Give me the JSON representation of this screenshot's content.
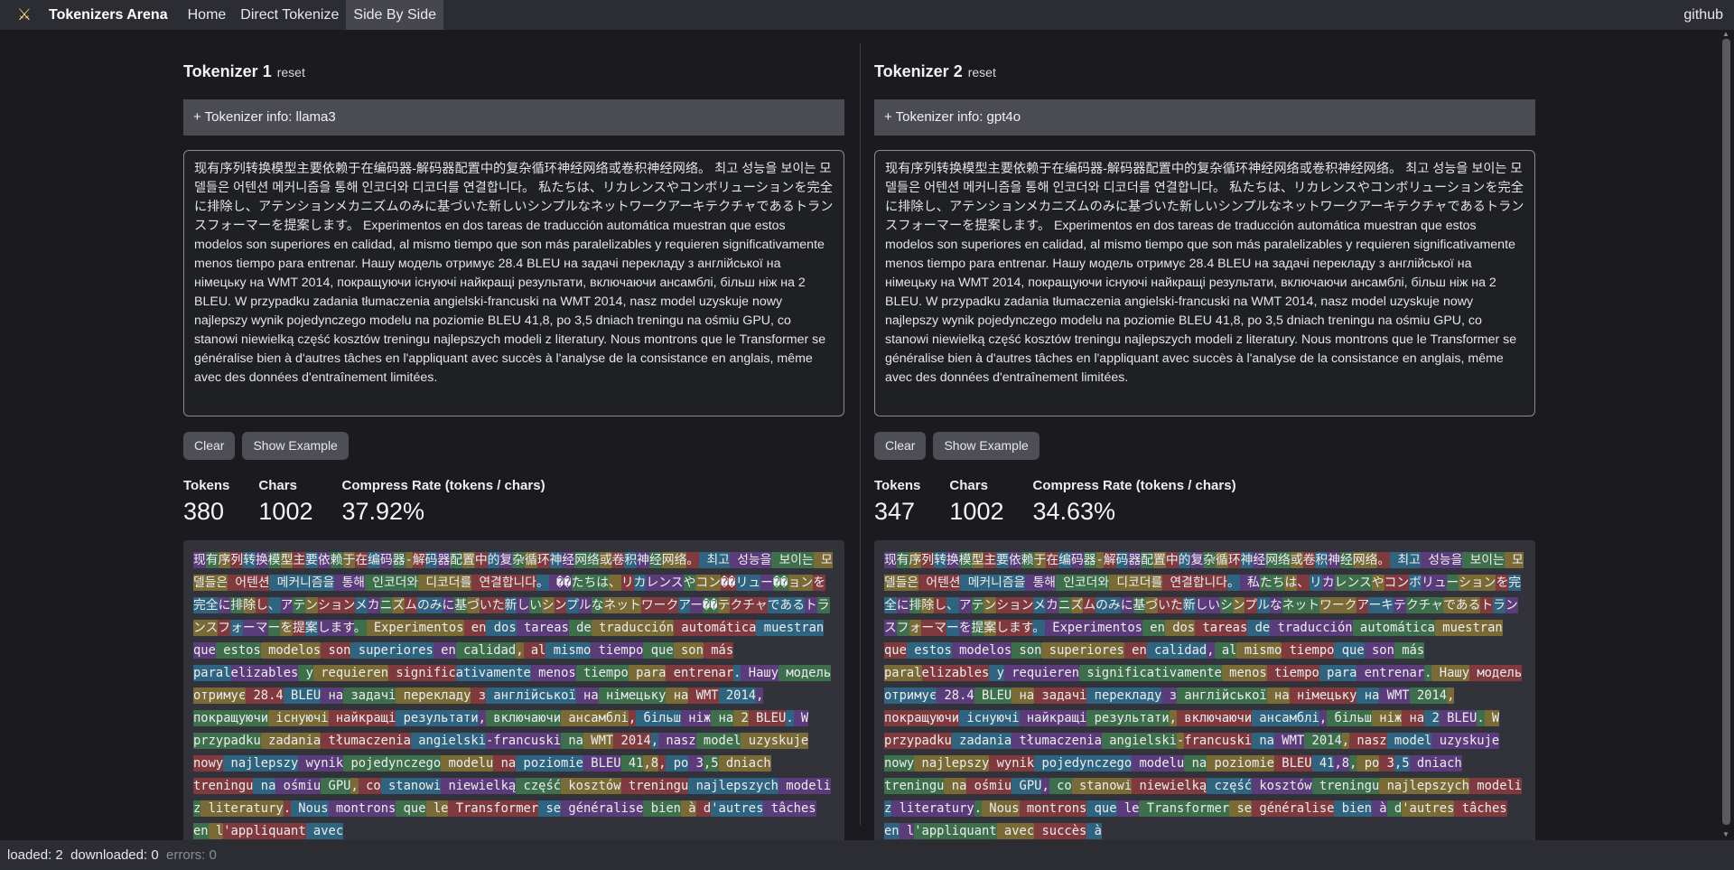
{
  "nav": {
    "brand": "Tokenizers Arena",
    "links": [
      {
        "label": "Home"
      },
      {
        "label": "Direct Tokenize"
      },
      {
        "label": "Side By Side"
      }
    ],
    "github": "github"
  },
  "input_text": "现有序列转换模型主要依赖于在编码器-解码器配置中的复杂循环神经网络或卷积神经网络。 최고 성능을 보이는 모델들은 어텐션 메커니즘을 통해 인코더와 디코더를 연결합니다。 私たちは、リカレンスやコンボリューションを完全に排除し、アテンションメカニズムのみに基づいた新しいシンプルなネットワークアーキテクチャであるトランスフォーマーを提案します。 Experimentos en dos tareas de traducción automática muestran que estos modelos son superiores en calidad, al mismo tiempo que son más paralelizables y requieren significativamente menos tiempo para entrenar. Нашу модель отримує 28.4 BLEU на задачі перекладу з англійської на німецьку на WMT 2014, покращуючи існуючі найкращі результати, включаючи ансамблі, більш ніж на 2 BLEU. W przypadku zadania tłumaczenia angielski-francuski na WMT 2014, nasz model uzyskuje nowy najlepszy wynik pojedynczego modelu na poziomie BLEU 41,8, po 3,5 dniach treningu na ośmiu GPU, co stanowi niewielką część kosztów treningu najlepszych modeli z literatury. Nous montrons que le Transformer se généralise bien à d'autres tâches en l'appliquant avec succès à l'analyse de la consistance en anglais, même avec des données d'entraînement limitées.",
  "buttons": {
    "clear": "Clear",
    "show_example": "Show Example"
  },
  "stat_labels": {
    "tokens": "Tokens",
    "chars": "Chars",
    "compress": "Compress Rate (tokens / chars)"
  },
  "reset_label": "reset",
  "panels": [
    {
      "title": "Tokenizer 1",
      "info": "+ Tokenizer info: llama3",
      "tokens": "380",
      "chars": "1002",
      "compress": "37.92%",
      "token_list": [
        "现",
        "有",
        "序",
        "列",
        "转",
        "换",
        "模",
        "型",
        "主",
        "要",
        "依",
        "赖",
        "于",
        "在",
        "编",
        "码",
        "器",
        "-",
        "解",
        "码",
        "器",
        "配",
        "置",
        "中",
        "的",
        "复",
        "杂",
        "循",
        "环",
        "神",
        "经",
        "网络",
        "或",
        "卷",
        "积",
        "神",
        "经",
        "网络",
        "。",
        " 최고",
        " 성능을",
        " 보이는",
        " 모델들은",
        " 어텐션",
        " 메커니즘을",
        " 통해",
        " 인코더와",
        " 디코더를",
        " 연결합니다",
        "。",
        " ��",
        "たちは",
        "、",
        "リ",
        "カ",
        "レンス",
        "や",
        "コン",
        "��",
        "リュ",
        "ー",
        "��",
        "ョン",
        "を",
        "完全",
        "に",
        "排",
        "除",
        "し",
        "、",
        "ア",
        "テ",
        "ン",
        "ション",
        "メ",
        "カ",
        "ニ",
        "ズ",
        "ム",
        "のみ",
        "に",
        "基",
        "づ",
        "いた",
        "新",
        "し",
        "い",
        "シ",
        "ン",
        "プ",
        "ル",
        "な",
        "ネット",
        "ワーク",
        "ア",
        "ー",
        "��",
        "テ",
        "クチャ",
        "である",
        "ト",
        "ラ",
        "ンス",
        "フ",
        "ォ",
        "ーマ",
        "ー",
        "を",
        "提",
        "案",
        "します",
        "。",
        " Experimentos",
        " en",
        " dos",
        " tareas",
        " de",
        " traducción",
        " automática",
        " muestran",
        " que",
        " estos",
        " modelos",
        " son",
        " superiores",
        " en",
        " calidad",
        ",",
        " al",
        " mismo",
        " tiempo",
        " que",
        " son",
        " más",
        " paral",
        "elizables",
        " y",
        " requieren",
        " signific",
        "ativamente",
        " menos",
        " tiempo",
        " para",
        " entrenar",
        ".",
        " Нашу",
        " модель",
        " отримує",
        " 28.4",
        " BLEU",
        " на",
        " задачі",
        " перекладу",
        " з",
        " англійської",
        " на",
        " німецьку",
        " на",
        " WMT",
        " 2014",
        ",",
        " покращуючи",
        " існуючі",
        " найкращі",
        " результати",
        ",",
        " включаючи",
        " ансамблі",
        ",",
        " більш",
        " ніж",
        " на",
        " 2",
        " BLEU",
        ".",
        " W",
        " przypadku",
        " zadania",
        " tłumaczenia",
        " angielski",
        "-francuski",
        " na",
        " WMT",
        " 2014",
        ",",
        " nasz",
        " model",
        " uzyskuje",
        " nowy",
        " najlepszy",
        " wynik",
        " pojedynczego",
        " modelu",
        " na",
        " poziomie",
        " BLEU",
        " 41",
        ",8",
        ",",
        " po",
        " 3",
        ",5",
        " dniach",
        " treningu",
        " na",
        " ośmiu",
        " GPU",
        ",",
        " co",
        " stanowi",
        " niewielką",
        " część",
        " kosztów",
        " treningu",
        " najlepszych",
        " modeli",
        " z",
        " literatury",
        ".",
        " Nous",
        " montrons",
        " que",
        " le",
        " Transformer",
        " se",
        " généralise",
        " bien",
        " à",
        " d",
        "'autres",
        " tâches",
        " en",
        " l",
        "'appliquant",
        " avec"
      ]
    },
    {
      "title": "Tokenizer 2",
      "info": "+ Tokenizer info: gpt4o",
      "tokens": "347",
      "chars": "1002",
      "compress": "34.63%",
      "token_list": [
        "现",
        "有",
        "序",
        "列",
        "转",
        "换",
        "模",
        "型",
        "主",
        "要",
        "依",
        "赖",
        "于",
        "在",
        "编",
        "码",
        "器",
        "-",
        "解",
        "码",
        "器",
        "配",
        "置",
        "中",
        "的",
        "复",
        "杂",
        "循",
        "环",
        "神",
        "经",
        "网络",
        "或",
        "卷",
        "积",
        "神",
        "经",
        "网络",
        "。",
        " 최고",
        " 성능을",
        " 보이는",
        " 모델들은",
        " 어텐션",
        " 메커니즘을",
        " 통해",
        " 인코더와",
        " 디코더를",
        " 연결합니다",
        "。",
        " 私",
        "たち",
        "は",
        "、",
        "リ",
        "カ",
        "レンス",
        "や",
        "コン",
        "ボ",
        "リュ",
        "ー",
        "ション",
        "を",
        "完全",
        "に",
        "排",
        "除",
        "し",
        "、",
        "ア",
        "テ",
        "ン",
        "ション",
        "メ",
        "カ",
        "ニ",
        "ズ",
        "ム",
        "のみ",
        "に",
        "基",
        "づ",
        "いた",
        "新",
        "しい",
        "シ",
        "ン",
        "プ",
        "ル",
        "な",
        "ネット",
        "ワーク",
        "ア",
        "ーキ",
        "テ",
        "クチャ",
        "である",
        "ト",
        "ラ",
        "ンス",
        "フ",
        "ォ",
        "ーマ",
        "ー",
        "を",
        "提",
        "案",
        "します",
        "。",
        " Experimentos",
        " en",
        " dos",
        " tareas",
        " de",
        " traducción",
        " automática",
        " muestran",
        " que",
        " estos",
        " modelos",
        " son",
        " superiores",
        " en",
        " calidad",
        ",",
        " al",
        " mismo",
        " tiempo",
        " que",
        " son",
        " más",
        " paral",
        "elizables",
        " y",
        " requieren",
        " significativamente",
        " menos",
        " tiempo",
        " para",
        " entrenar",
        ".",
        " Нашу",
        " модель",
        " отримує",
        " 28.4",
        " BLEU",
        " на",
        " задачі",
        " перекладу",
        " з",
        " англійської",
        " на",
        " німецьку",
        " на",
        " WMT",
        " 2014",
        ",",
        " покращуючи",
        " існуючі",
        " найкращі",
        " результати",
        ",",
        " включаючи",
        " ансамблі",
        ",",
        " більш",
        " ніж",
        " на",
        " 2",
        " BLEU",
        ".",
        " W",
        " przypadku",
        " zadania",
        " tłumaczenia",
        " angielski",
        "-",
        "francuski",
        " na",
        " WMT",
        " 2014",
        ",",
        " nasz",
        " model",
        " uzyskuje",
        " nowy",
        " najlepszy",
        " wynik",
        " pojedynczego",
        " modelu",
        " na",
        " poziomie",
        " BLEU",
        " 41",
        ",8",
        ",",
        " po",
        " 3",
        ",5",
        " dniach",
        " treningu",
        " na",
        " ośmiu",
        " GPU",
        ",",
        " co",
        " stanowi",
        " niewielką",
        " część",
        " kosztów",
        " treningu",
        " najlepszych",
        " modeli",
        " z",
        " literatury",
        ".",
        " Nous",
        " montrons",
        " que",
        " le",
        " Transformer",
        " se",
        " généralise",
        " bien",
        " à",
        " d",
        "'autres",
        " tâches",
        " en",
        " l",
        "'appliquant",
        " avec",
        " succès",
        " à"
      ]
    }
  ],
  "status": {
    "loaded": "loaded: 2",
    "downloaded": "downloaded: 0",
    "errors": "errors: 0"
  }
}
